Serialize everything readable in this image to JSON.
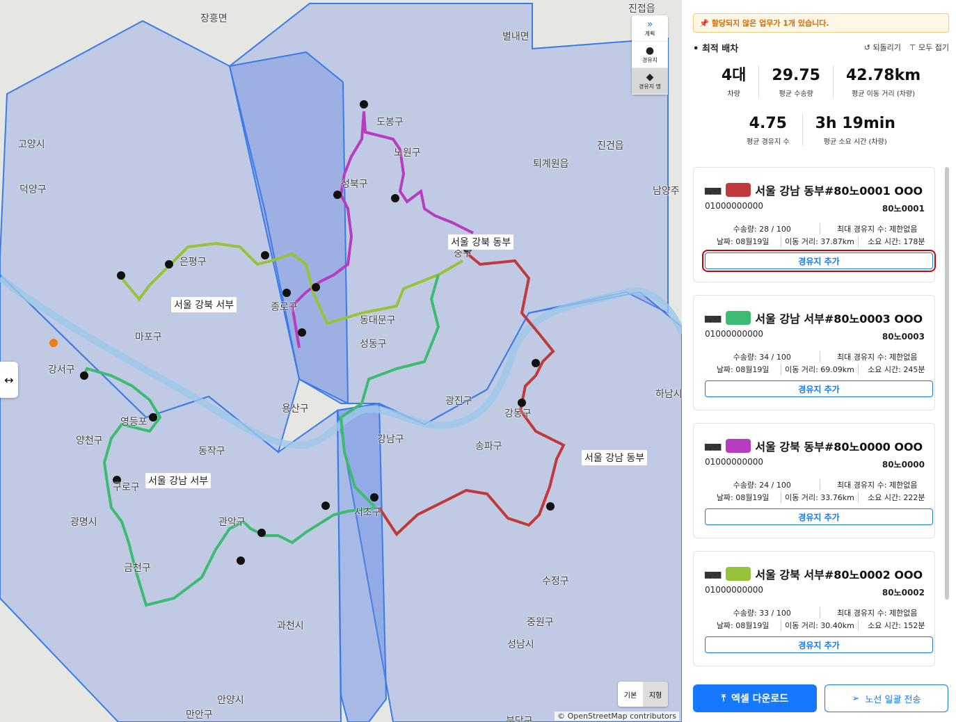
{
  "map": {
    "place_labels": [
      "진접읍",
      "장흥면",
      "별내면",
      "고양시",
      "덕양구",
      "도봉구",
      "노원구",
      "성북구",
      "진건읍",
      "퇴계원읍",
      "남양주",
      "은평구",
      "종로구",
      "동대문구",
      "중구",
      "성동구",
      "마포구",
      "강서구",
      "영등포",
      "양천구",
      "동작구",
      "용산구",
      "광진구",
      "강동구",
      "하남시",
      "송파구",
      "강남구",
      "구로구",
      "광명시",
      "관악구",
      "서초구",
      "금천구",
      "수정구",
      "중원구",
      "과천시",
      "성남시",
      "안양시",
      "만안구",
      "분당구"
    ],
    "regions": [
      "서울 강북 동부",
      "서울 강북 서부",
      "서울 강남 동부",
      "서울 강남 서부"
    ],
    "controls": {
      "plan": "계획",
      "waypoint": "경유지",
      "waypoint_name": "경유지 명"
    },
    "layers": {
      "basic": "기본",
      "terrain": "지형"
    },
    "attribution": "© OpenStreetMap contributors"
  },
  "alert": "할당되지 않은 업무가 1개 있습니다.",
  "header": {
    "title": "최적 배차",
    "revert": "되돌리기",
    "collapse_all": "모두 접기"
  },
  "stats": {
    "vehicles": {
      "value": "4대",
      "label": "차량"
    },
    "avg_load": {
      "value": "29.75",
      "label": "평균 수송량"
    },
    "avg_distance": {
      "value": "42.78km",
      "label": "평균 이동 거리 (차량)"
    },
    "avg_waypoints": {
      "value": "4.75",
      "label": "평균 경유지 수"
    },
    "avg_time": {
      "value": "3h 19min",
      "label": "평균 소요 시간 (차량)"
    }
  },
  "vehicles": [
    {
      "color": "#c0393b",
      "title": "서울 강남 동부#80노0001 OOO",
      "phone": "01000000000",
      "plate": "80노0001",
      "load": "수송량: 28 / 100",
      "max_wp": "최대 경유지 수: 제한없음",
      "date": "날짜: 08월19일",
      "distance": "이동 거리: 37.87km",
      "time": "소요 시간: 178분",
      "add": "경유지 추가"
    },
    {
      "color": "#3dbb72",
      "title": "서울 강남 서부#80노0003 OOO",
      "phone": "01000000000",
      "plate": "80노0003",
      "load": "수송량: 34 / 100",
      "max_wp": "최대 경유지 수: 제한없음",
      "date": "날짜: 08월19일",
      "distance": "이동 거리: 69.09km",
      "time": "소요 시간: 245분",
      "add": "경유지 추가"
    },
    {
      "color": "#b83cbf",
      "title": "서울 강북 동부#80노0000 OOO",
      "phone": "01000000000",
      "plate": "80노0000",
      "load": "수송량: 24 / 100",
      "max_wp": "최대 경유지 수: 제한없음",
      "date": "날짜: 08월19일",
      "distance": "이동 거리: 33.76km",
      "time": "소요 시간: 222분",
      "add": "경유지 추가"
    },
    {
      "color": "#98c23a",
      "title": "서울 강북 서부#80노0002 OOO",
      "phone": "01000000000",
      "plate": "80노0002",
      "load": "수송량: 33 / 100",
      "max_wp": "최대 경유지 수: 제한없음",
      "date": "날짜: 08월19일",
      "distance": "이동 거리: 30.40km",
      "time": "소요 시간: 152분",
      "add": "경유지 추가"
    }
  ],
  "footer": {
    "excel": "엑셀 다운로드",
    "send": "노선 일괄 전송"
  }
}
